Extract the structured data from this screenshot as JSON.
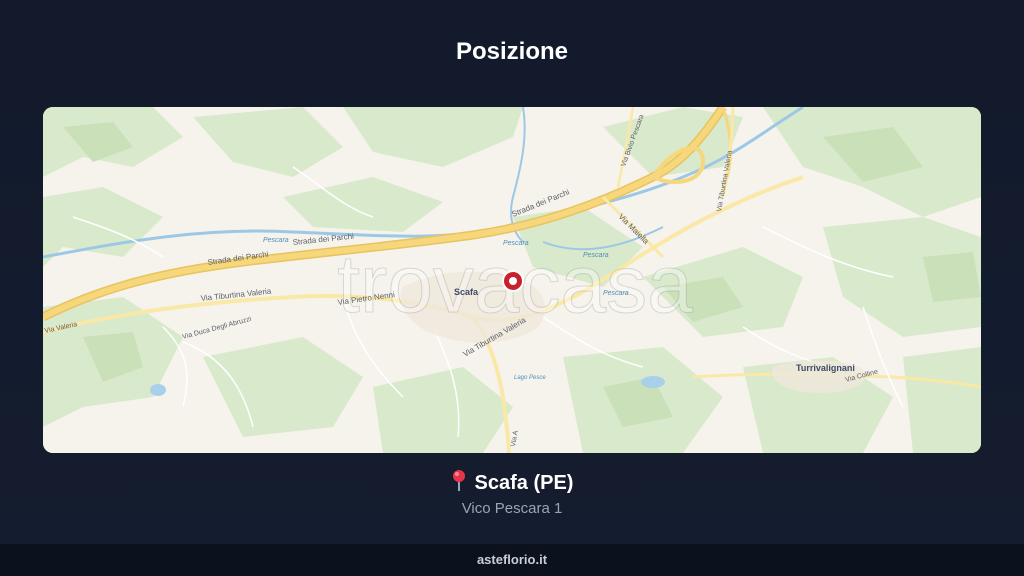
{
  "header": {
    "title": "Posizione"
  },
  "map": {
    "watermark": "trovacasa",
    "places": {
      "town": "Scafa",
      "village": "Turrivalignani",
      "lake": "Lago Pesce"
    },
    "roads": {
      "strada_parchi_1": "Strada dei Parchi",
      "strada_parchi_2": "Strada dei Parchi",
      "strada_parchi_3": "Strada dei Parchi",
      "via_tiburtina_w": "Via Tiburtina Valeria",
      "via_tiburtina_s": "Via Tiburtina Valeria",
      "via_tiburtina_ne": "Via Tiburtina Valeria",
      "via_tiburtina_edge": "Via Valeria",
      "via_pietro_nenni": "Via Pietro Nenni",
      "via_duca_abruzzi": "Via Duca Degli Abruzzi",
      "via_maiella": "Via Maiella",
      "via_bivio_pescara": "Via Bivio Pescara",
      "via_a": "Via A",
      "via_colline": "Via Colline"
    },
    "rivers": {
      "pescara_1": "Pescara",
      "pescara_2": "Pescara",
      "pescara_3": "Pescara",
      "pescara_4": "Pescara"
    },
    "marker_icon": "location-pin-icon",
    "colors": {
      "land": "#f6f3ec",
      "forest": "#d6e8c8",
      "motorway": "#f7d77c",
      "water": "#9cc8e6",
      "marker": "#c8202f"
    }
  },
  "location": {
    "pin_icon": "pushpin-icon",
    "name": "Scafa (PE)",
    "address": "Vico Pescara 1"
  },
  "footer": {
    "site": "asteflorio.it"
  }
}
